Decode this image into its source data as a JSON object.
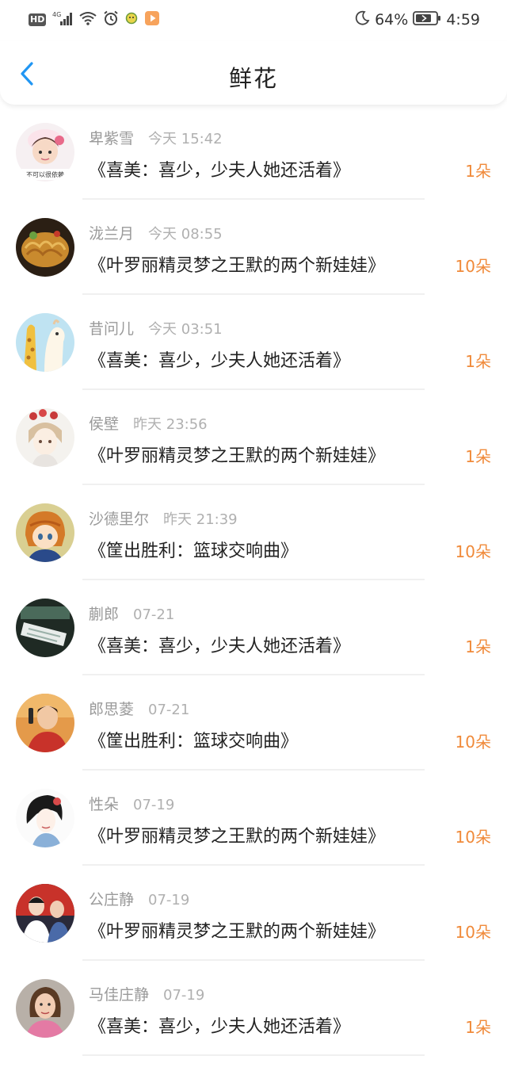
{
  "status_bar": {
    "hd": "HD",
    "net": "4G",
    "battery_pct": "64%",
    "time": "4:59",
    "icons": [
      "signal-icon",
      "wifi-icon",
      "alarm-icon",
      "app-icon",
      "play-icon",
      "moon-icon",
      "battery-icon"
    ]
  },
  "header": {
    "title": "鲜花",
    "back_icon": "chevron-left-icon"
  },
  "colors": {
    "accent": "#f08a3a",
    "back_blue": "#2196f3"
  },
  "rows": [
    {
      "name": "卑紫雪",
      "time": "今天 15:42",
      "book": "《喜美：喜少，少夫人她还活着》",
      "count": "1朵",
      "avatar_caption": "不可以很依赖"
    },
    {
      "name": "泷兰月",
      "time": "今天 08:55",
      "book": "《叶罗丽精灵梦之王默的两个新娃娃》",
      "count": "10朵"
    },
    {
      "name": "昔问儿",
      "time": "今天 03:51",
      "book": "《喜美：喜少，少夫人她还活着》",
      "count": "1朵"
    },
    {
      "name": "侯壁",
      "time": "昨天 23:56",
      "book": "《叶罗丽精灵梦之王默的两个新娃娃》",
      "count": "1朵"
    },
    {
      "name": "沙德里尔",
      "time": "昨天 21:39",
      "book": "《筐出胜利：篮球交响曲》",
      "count": "10朵"
    },
    {
      "name": "蒯郎",
      "time": "07-21",
      "book": "《喜美：喜少，少夫人她还活着》",
      "count": "1朵"
    },
    {
      "name": "郎思菱",
      "time": "07-21",
      "book": "《筐出胜利：篮球交响曲》",
      "count": "10朵"
    },
    {
      "name": "性朵",
      "time": "07-19",
      "book": "《叶罗丽精灵梦之王默的两个新娃娃》",
      "count": "10朵"
    },
    {
      "name": "公庄静",
      "time": "07-19",
      "book": "《叶罗丽精灵梦之王默的两个新娃娃》",
      "count": "10朵"
    },
    {
      "name": "马佳庄静",
      "time": "07-19",
      "book": "《喜美：喜少，少夫人她还活着》",
      "count": "1朵"
    }
  ]
}
